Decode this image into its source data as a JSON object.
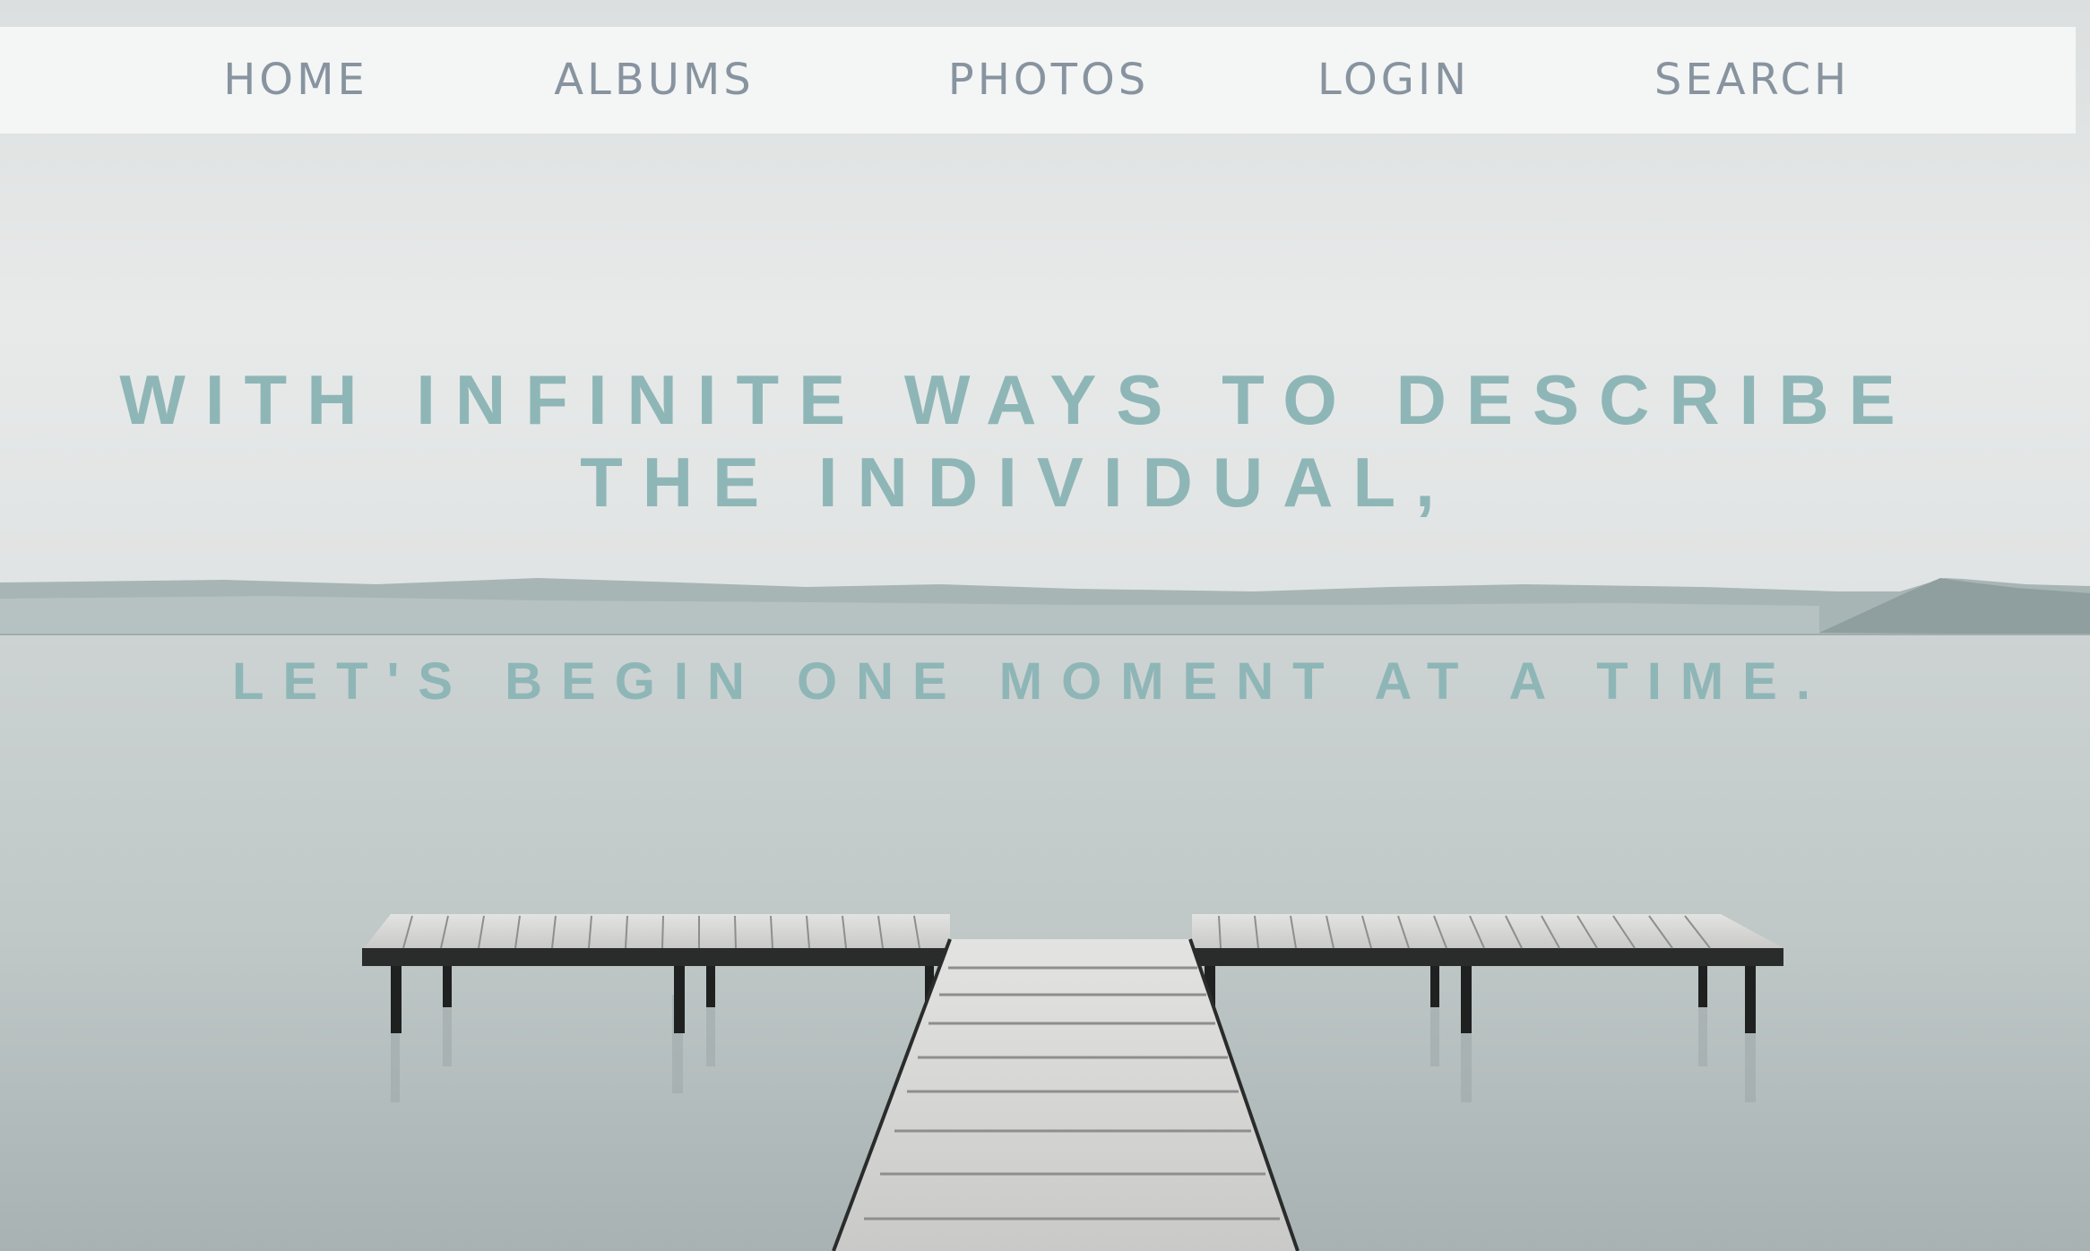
{
  "nav": {
    "items": [
      {
        "label": "HOME"
      },
      {
        "label": "ALBUMS"
      },
      {
        "label": "PHOTOS"
      },
      {
        "label": "LOGIN"
      },
      {
        "label": "SEARCH"
      }
    ]
  },
  "hero": {
    "headline": "WITH INFINITE WAYS TO DESCRIBE THE INDIVIDUAL,",
    "subline": "LET'S BEGIN ONE MOMENT AT A TIME."
  },
  "colors": {
    "nav_text": "#8794a0",
    "hero_text": "#8fb6b7",
    "nav_background": "#f5f6f6"
  }
}
